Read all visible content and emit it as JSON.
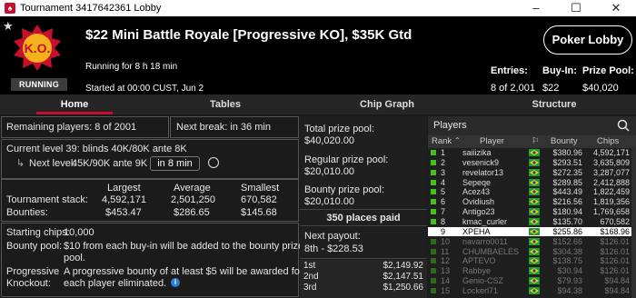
{
  "window": {
    "title": "Tournament 3417642361 Lobby",
    "icon": "pokerstars-icon",
    "minimize": "–",
    "maximize": "☐",
    "close": "✕"
  },
  "header": {
    "tournament_name": "$22 Mini Battle Royale [Progressive KO], $35K Gtd",
    "logo_text": "K.O.",
    "status_badge": "RUNNING",
    "running_for": "Running for 8 h 18 min",
    "started_at": "Started at 00:00 CUST, Jun 2",
    "lobby_button": "Poker Lobby",
    "entries_label": "Entries:",
    "entries_value": "8 of 2,001",
    "buyin_label": "Buy-In:",
    "buyin_value": "$22",
    "prizepool_label": "Prize Pool:",
    "prizepool_value": "$40,020"
  },
  "tabs": [
    "Home",
    "Tables",
    "Chip Graph",
    "Structure"
  ],
  "home": {
    "remaining_players": "Remaining players: 8 of 2001",
    "next_break": "Next break: in 36 min",
    "current_level": "Current level 39:  blinds 40K/80K ante 8K",
    "next_level_label": "Next level:",
    "next_level_value": "45K/90K ante 9K",
    "next_level_time": "in 8 min",
    "stats_headers": [
      "Largest",
      "Average",
      "Smallest"
    ],
    "stack_label": "Tournament stack:",
    "stack_values": [
      "4,592,171",
      "2,501,250",
      "670,582"
    ],
    "bounties_label": "Bounties:",
    "bounties_values": [
      "$453.47",
      "$286.65",
      "$145.68"
    ],
    "starting_chips_label": "Starting chips:",
    "starting_chips_value": "10,000",
    "bounty_pool_label": "Bounty pool:",
    "bounty_pool_line1": "$10 from each buy-in will be added to the bounty prize",
    "bounty_pool_line2": "pool.",
    "progressive_label_1": "Progressive",
    "progressive_label_2": "Knockout:",
    "progressive_line1": "A progressive bounty of at least $5 will be awarded for",
    "progressive_line2": "each player eliminated."
  },
  "prizes": {
    "total_label": "Total prize pool:",
    "total_value": "$40,020.00",
    "regular_label": "Regular prize pool:",
    "regular_value": "$20,010.00",
    "bounty_label": "Bounty prize pool:",
    "bounty_value": "$20,010.00",
    "places_paid": "350 places paid",
    "next_payout_label": "Next payout:",
    "next_payout_value": "8th - $228.53",
    "payouts": [
      {
        "place": "1st",
        "amount": "$2,149.92"
      },
      {
        "place": "2nd",
        "amount": "$2,147.51"
      },
      {
        "place": "3rd",
        "amount": "$1,250.66"
      }
    ]
  },
  "players": {
    "title": "Players",
    "columns": [
      "Rank",
      "Player",
      "Bounty",
      "Chips"
    ],
    "rows": [
      {
        "rank": "1",
        "name": "saiiizika",
        "bounty": "$380.96",
        "chips": "4,592,171",
        "flag": "brazil"
      },
      {
        "rank": "2",
        "name": "vesenick9",
        "bounty": "$293.51",
        "chips": "3,635,809",
        "flag": "brazil"
      },
      {
        "rank": "3",
        "name": "revelator13",
        "bounty": "$272.35",
        "chips": "3,287,077",
        "flag": "brazil"
      },
      {
        "rank": "4",
        "name": "Sepeqe",
        "bounty": "$289.85",
        "chips": "2,412,888",
        "flag": "brazil"
      },
      {
        "rank": "5",
        "name": "Acez43",
        "bounty": "$443.49",
        "chips": "1,822,459",
        "flag": "brazil"
      },
      {
        "rank": "6",
        "name": "Ovidiush",
        "bounty": "$216.56",
        "chips": "1,819,356",
        "flag": "brazil"
      },
      {
        "rank": "7",
        "name": "Antigo23",
        "bounty": "$180.94",
        "chips": "1,769,658",
        "flag": "brazil"
      },
      {
        "rank": "8",
        "name": "kmac_curler",
        "bounty": "$135.70",
        "chips": "670,582",
        "flag": "brazil"
      },
      {
        "rank": "9",
        "name": "XPEHA",
        "bounty": "$255.86",
        "chips": "$168.96",
        "flag": "brazil"
      },
      {
        "rank": "10",
        "name": "navarro0011",
        "bounty": "$152.66",
        "chips": "$126.01",
        "flag": "brazil"
      },
      {
        "rank": "11",
        "name": "CHUMBAELES",
        "bounty": "$304.38",
        "chips": "$126.01",
        "flag": "brazil"
      },
      {
        "rank": "12",
        "name": "APTEVO",
        "bounty": "$138.75",
        "chips": "$126.01",
        "flag": "brazil"
      },
      {
        "rank": "13",
        "name": "Rabbye",
        "bounty": "$30.94",
        "chips": "$126.01",
        "flag": "brazil"
      },
      {
        "rank": "14",
        "name": "Genio-CSZ",
        "bounty": "$79.93",
        "chips": "$94.84",
        "flag": "brazil"
      },
      {
        "rank": "15",
        "name": "Lockerl71",
        "bounty": "$94.38",
        "chips": "$94.84",
        "flag": "brazil"
      }
    ]
  },
  "colors": {
    "accent": "#c8102e",
    "active_player": "#44c21b",
    "flag_green": "#1e9c3a",
    "flag_yellow": "#f5d30f"
  }
}
